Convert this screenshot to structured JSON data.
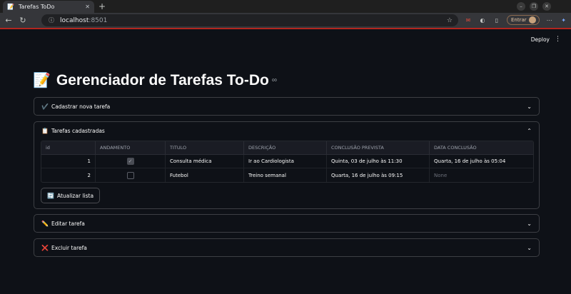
{
  "browser": {
    "tab_title": "Tarefas ToDo",
    "tab_favicon": "📝",
    "url_host": "localhost",
    "url_port": ":8501",
    "signin_label": "Entrar"
  },
  "app": {
    "deploy_label": "Deploy",
    "title": "Gerenciador de Tarefas To-Do",
    "title_emoji": "📝",
    "title_link_icon": "∞"
  },
  "expanders": {
    "cadastrar": {
      "icon": "✔️",
      "label": "Cadastrar nova tarefa",
      "chevron": "⌄"
    },
    "tarefas": {
      "icon": "📋",
      "label": "Tarefas cadastradas",
      "chevron": "⌃"
    },
    "editar": {
      "icon": "✏️",
      "label": "Editar tarefa",
      "chevron": "⌄"
    },
    "excluir": {
      "icon": "❌",
      "label": "Excluir tarefa",
      "chevron": "⌄"
    }
  },
  "table": {
    "columns": [
      "id",
      "ANDAMENTO",
      "TITULO",
      "DESCRIÇÃO",
      "CONCLUSÃO PREVISTA",
      "DATA CONCLUSÃO"
    ],
    "rows": [
      {
        "id": "1",
        "andamento": true,
        "titulo": "Consulta médica",
        "descricao": "Ir ao Cardiologista",
        "conclusao_prevista": "Quinta, 03 de julho às 11:30",
        "data_conclusao": "Quarta, 16 de julho às 05:04"
      },
      {
        "id": "2",
        "andamento": false,
        "titulo": "Futebol",
        "descricao": "Treino semanal",
        "conclusao_prevista": "Quarta, 16 de julho às 09:15",
        "data_conclusao": "None"
      }
    ]
  },
  "refresh_button": {
    "icon": "🔄",
    "label": "Atualizar lista"
  }
}
